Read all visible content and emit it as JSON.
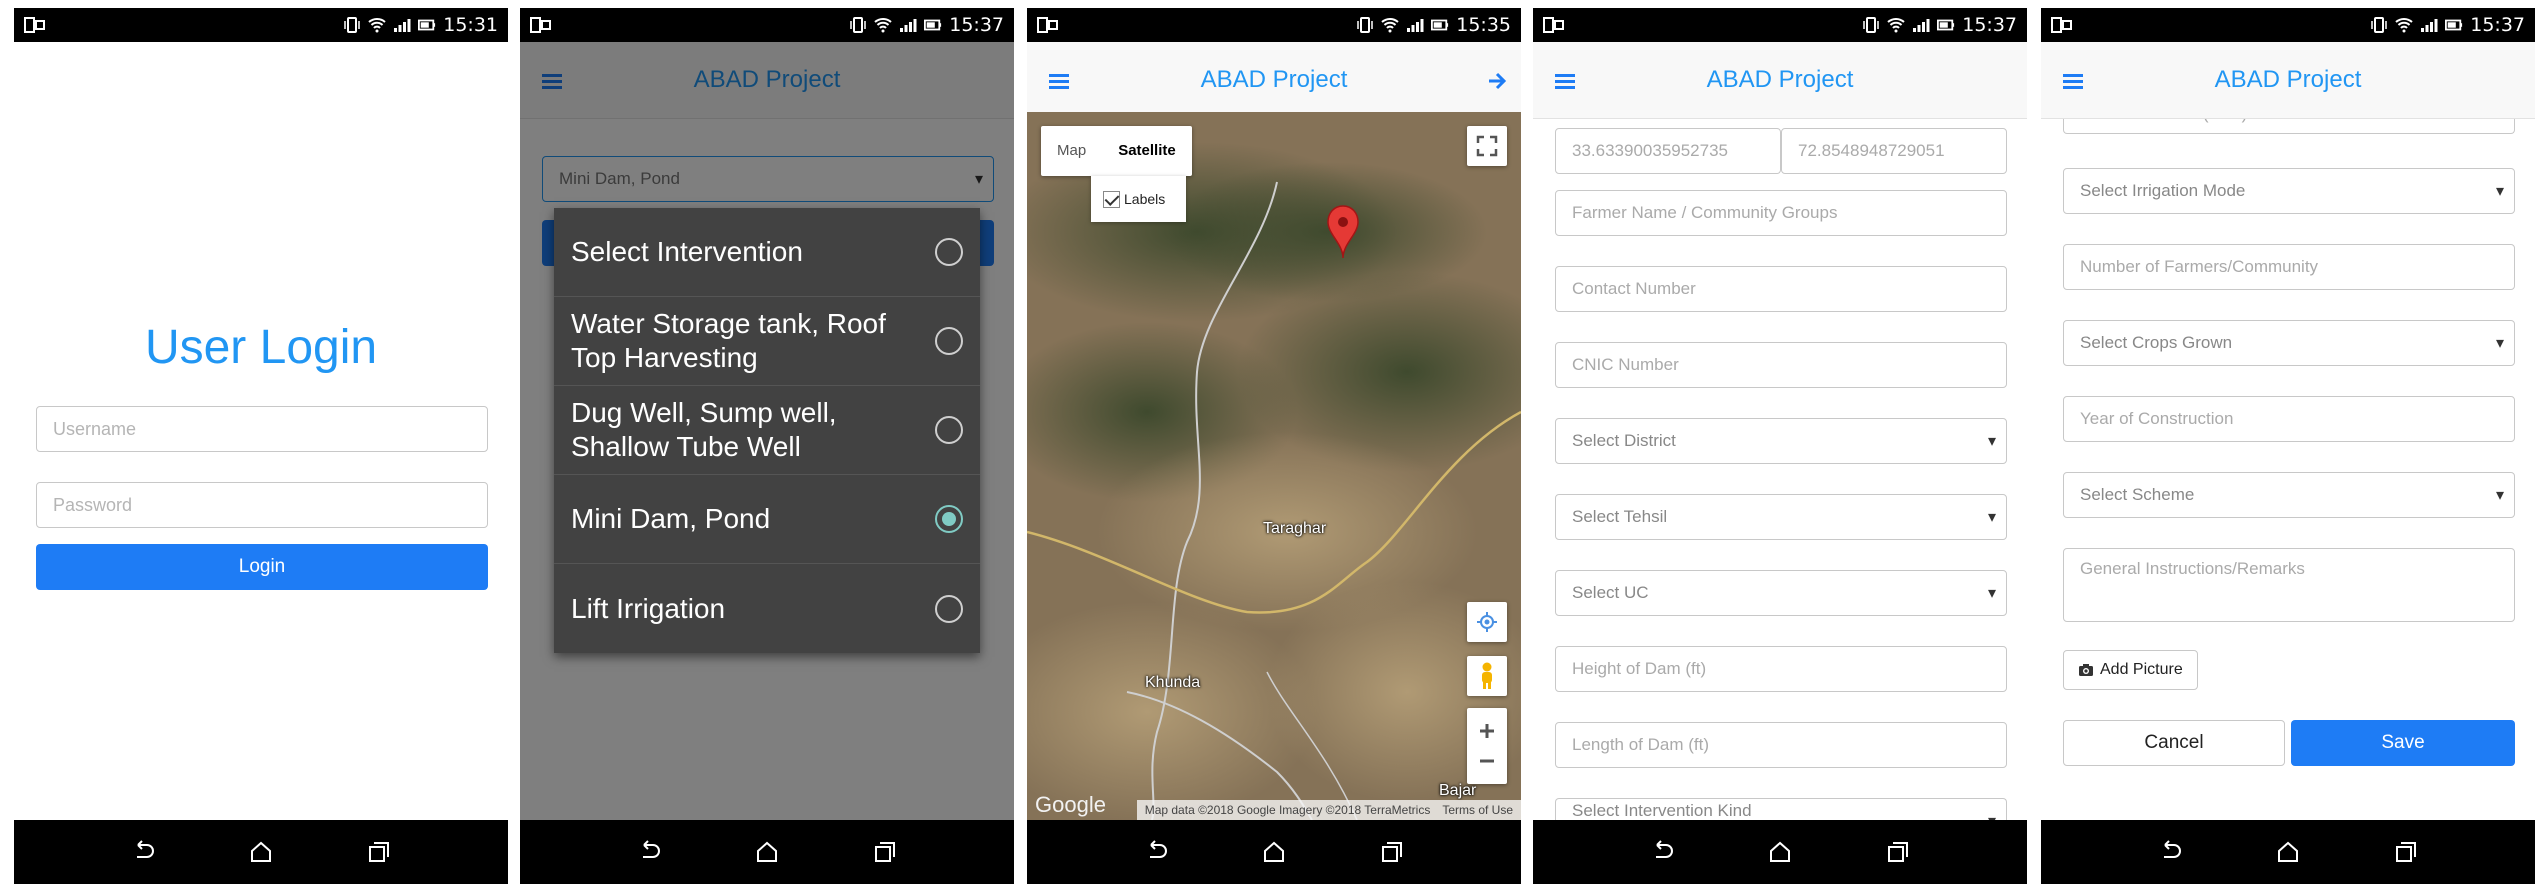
{
  "status_times": [
    "15:31",
    "15:37",
    "15:35",
    "15:37",
    "15:37"
  ],
  "app_title": "ABAD Project",
  "login": {
    "title": "User Login",
    "username_placeholder": "Username",
    "password_placeholder": "Password",
    "login_label": "Login"
  },
  "intervention_dialog": {
    "selected_value": "Mini Dam, Pond",
    "options": [
      {
        "label": "Select Intervention",
        "selected": false
      },
      {
        "label": "Water Storage tank, Roof Top Harvesting",
        "selected": false
      },
      {
        "label": "Dug Well, Sump well, Shallow Tube Well",
        "selected": false
      },
      {
        "label": "Mini Dam, Pond",
        "selected": true
      },
      {
        "label": "Lift Irrigation",
        "selected": false
      }
    ]
  },
  "map_screen": {
    "map_tab": "Map",
    "satellite_tab": "Satellite",
    "labels_checkbox": "Labels",
    "places": [
      "Taraghar",
      "Khunda",
      "Bajar"
    ],
    "google_logo": "Google",
    "attribution": "Map data ©2018 Google Imagery ©2018 TerraMetrics",
    "terms": "Terms of Use"
  },
  "form1": {
    "latitude": "33.63390035952735",
    "longitude": "72.8548948729051",
    "fields": [
      "Farmer Name / Community Groups",
      "Contact Number",
      "CNIC Number",
      "Select District",
      "Select Tehsil",
      "Select UC",
      "Height of Dam (ft)",
      "Length of Dam (ft)",
      "Select Intervention Kind"
    ]
  },
  "form2": {
    "fields": [
      "Command Area (acre)",
      "Select Irrigation Mode",
      "Number of Farmers/Community",
      "Select Crops Grown",
      "Year of Construction",
      "Select Scheme",
      "General Instructions/Remarks"
    ],
    "add_picture": "Add Picture",
    "cancel": "Cancel",
    "save": "Save"
  },
  "colors": {
    "accent": "#2196f3",
    "primary_button": "#1e7cf5",
    "radio_selected": "#80cbc4"
  }
}
